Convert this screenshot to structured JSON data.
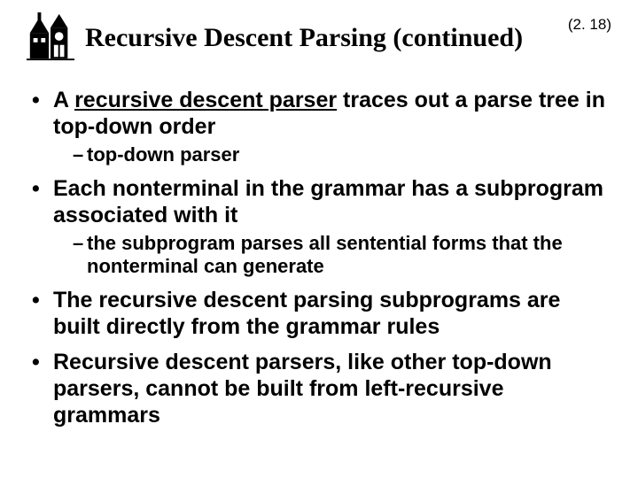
{
  "header": {
    "title": "Recursive Descent Parsing (continued)",
    "page_number": "(2. 18)"
  },
  "bullets": [
    {
      "html": "A <u>recursive descent parser</u> traces out a parse tree in top-down order",
      "sub": [
        "top-down parser"
      ]
    },
    {
      "html": "Each nonterminal in the grammar has a subprogram associated with it",
      "sub": [
        "the subprogram parses all sentential forms that the nonterminal can generate"
      ]
    },
    {
      "html": "The recursive descent parsing subprograms are built directly from the grammar rules",
      "sub": []
    },
    {
      "html": "Recursive descent parsers, like other top-down parsers, cannot be built from left-recursive grammars",
      "sub": []
    }
  ]
}
